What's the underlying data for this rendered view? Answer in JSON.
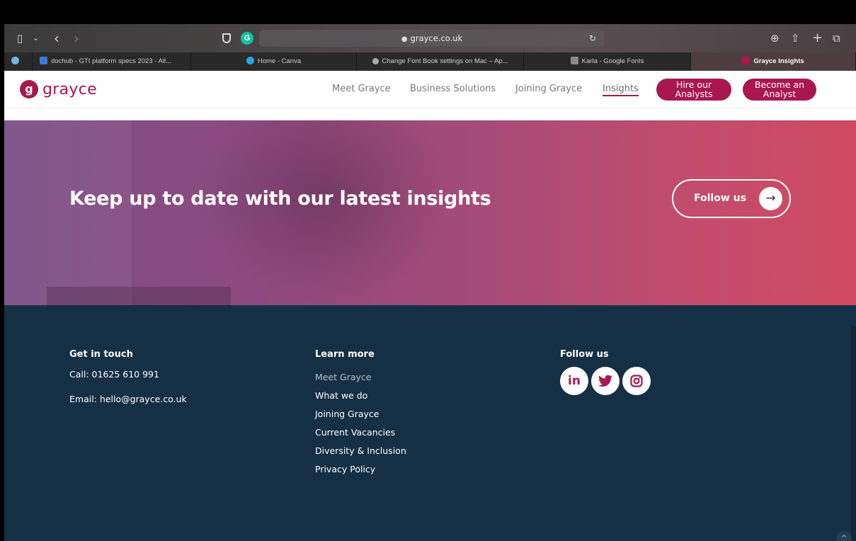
{
  "browser": {
    "url": "grayce.co.uk",
    "tabs": [
      {
        "label": "dochub - GTI platform specs 2023 - All...",
        "color": "#3a7bd5"
      },
      {
        "label": "Home - Canva",
        "color": "#26a4e0"
      },
      {
        "label": "Change Font Book settings on Mac – Ap...",
        "color": "#aaaaaa"
      },
      {
        "label": "Karla - Google Fonts",
        "color": "#8a8a8a"
      },
      {
        "label": "Grayce Insights",
        "color": "#a8184f"
      }
    ],
    "active_tab_index": 4,
    "icons": {
      "sidebar": "▯",
      "chevron": "⌄",
      "back": "‹",
      "forward": "›",
      "grammarly": "G",
      "lock": "🔒",
      "reload": "↻",
      "download": "⊕",
      "share": "⇧",
      "new_tab": "+",
      "tabs_overview": "⧉"
    }
  },
  "site": {
    "logo_mark": "g",
    "logo_text": "grayce",
    "brand_color": "#a8184f",
    "nav": [
      {
        "label": "Meet Grayce"
      },
      {
        "label": "Business Solutions"
      },
      {
        "label": "Joining Grayce"
      },
      {
        "label": "Insights"
      }
    ],
    "buttons": {
      "hire_line1": "Hire our",
      "hire_line2": "Analysts",
      "become_line1": "Become an",
      "become_line2": "Analyst"
    }
  },
  "hero": {
    "title": "Keep up to date with our latest insights",
    "follow_label": "Follow us",
    "arrow": "→"
  },
  "footer": {
    "bg_color": "#152f44",
    "contact": {
      "heading": "Get in touch",
      "phone": "Call: 01625 610 991",
      "email": "Email: hello@grayce.co.uk"
    },
    "learn": {
      "heading": "Learn more",
      "links": [
        "Meet Grayce",
        "What we do",
        "Joining Grayce",
        "Current Vacancies",
        "Diversity & Inclusion",
        "Privacy Policy"
      ]
    },
    "follow": {
      "heading": "Follow us",
      "icons": [
        {
          "name": "linkedin",
          "glyph": "in"
        },
        {
          "name": "twitter",
          "glyph": "🐦"
        },
        {
          "name": "instagram",
          "glyph": "◎"
        }
      ]
    },
    "scroll_top_glyph": "^"
  }
}
